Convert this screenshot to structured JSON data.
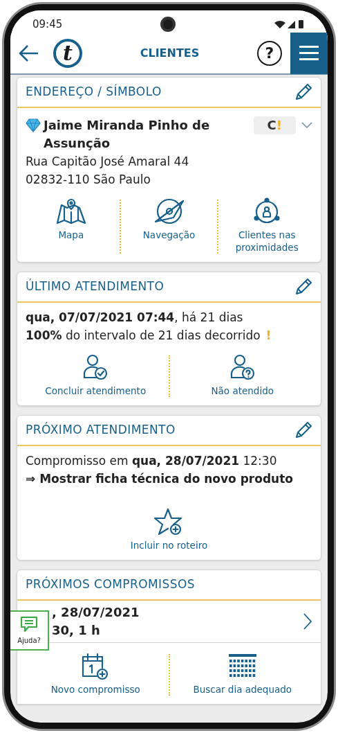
{
  "status_bar": {
    "time": "09:45"
  },
  "header": {
    "logo_letter": "t",
    "title": "CLIENTES",
    "help": "?"
  },
  "address_card": {
    "title": "ENDEREÇO / SÍMBOLO",
    "name": "Jaime Miranda Pinho de Assunção",
    "badge": {
      "letter": "C",
      "mark": "!"
    },
    "address": [
      "Rua Capitão José Amaral 44",
      "02832-110 São Paulo"
    ],
    "actions": [
      {
        "kind": "map",
        "label": "Mapa"
      },
      {
        "kind": "navigation",
        "label": "Navegação"
      },
      {
        "kind": "nearby",
        "label": "Clientes nas proximidades"
      }
    ]
  },
  "last_visit_card": {
    "title": "ÚLTIMO ATENDIMENTO",
    "lines": [
      "**qua, 07/07/2021 07:44**, há 21 dias",
      "**100%** do intervalo de 21 dias decorrido"
    ],
    "warning": "!",
    "actions": [
      {
        "kind": "person-check",
        "label": "Concluir atendimento"
      },
      {
        "kind": "person-question",
        "label": "Não atendido"
      }
    ]
  },
  "next_visit_card": {
    "title": "PRÓXIMO ATENDIMENTO",
    "line": "Compromisso em **qua, 28/07/2021** 12:30",
    "topic": "⇒ Mostrar ficha técnica do novo produto",
    "actions": [
      {
        "kind": "star-plus",
        "label": "Incluir no roteiro"
      }
    ]
  },
  "appointments_card": {
    "title": "PRÓXIMOS COMPROMISSOS",
    "item": {
      "lines": [
        ", 28/07/2021",
        "30, 1 h"
      ]
    },
    "actions": [
      {
        "kind": "calendar-plus",
        "label": "Novo compromisso"
      },
      {
        "kind": "calendar-grid",
        "label": "Buscar dia adequado"
      }
    ]
  },
  "help_tab": {
    "label": "Ajuda?"
  }
}
